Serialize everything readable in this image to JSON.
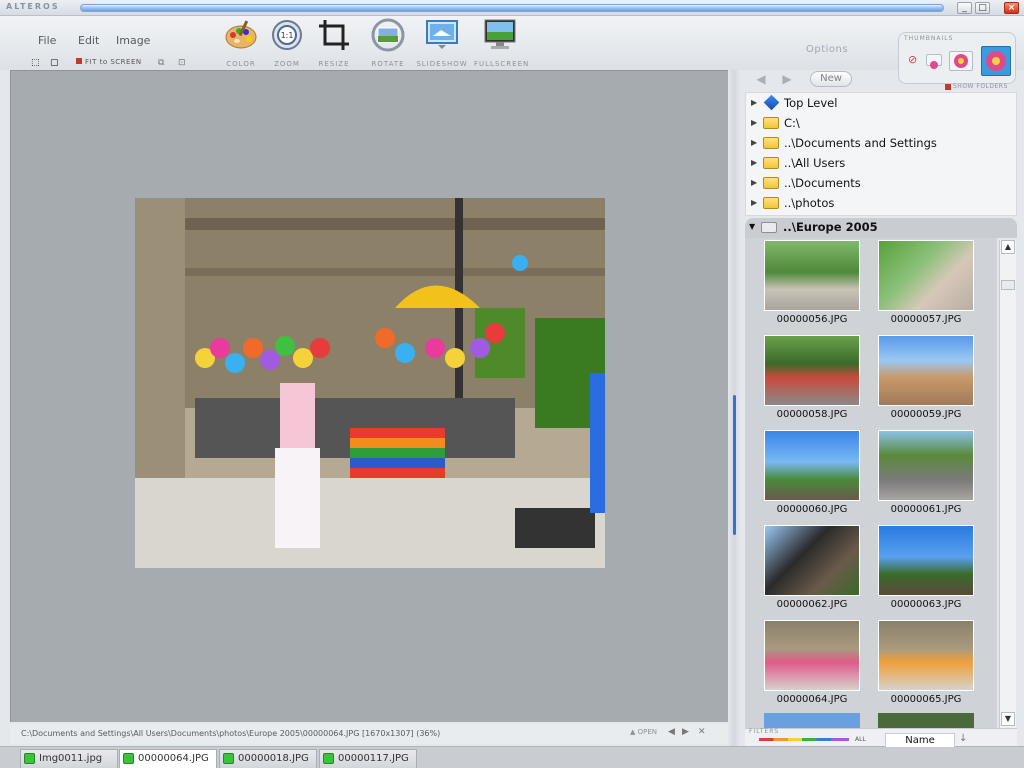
{
  "app": {
    "name": "ALTEROS"
  },
  "menu": {
    "file": "File",
    "edit": "Edit",
    "image": "Image"
  },
  "tools": [
    {
      "label": "COLOR",
      "icon": "palette-icon"
    },
    {
      "label": "ZOOM",
      "icon": "zoom-icon"
    },
    {
      "label": "RESIZE",
      "icon": "crop-icon"
    },
    {
      "label": "ROTATE",
      "icon": "rotate-icon"
    },
    {
      "label": "SLIDESHOW",
      "icon": "slideshow-icon"
    },
    {
      "label": "FULLSCREEN",
      "icon": "fullscreen-icon"
    }
  ],
  "options_label": "Options",
  "thumbnails_label": "THUMBNAILS",
  "fit_label": "FIT to SCREEN",
  "browser": {
    "new_label": "New",
    "show_folders": "SHOW FOLDERS",
    "tree": [
      {
        "label": "Top Level",
        "icon": "top-level-icon"
      },
      {
        "label": "C:\\",
        "icon": "folder-icon"
      },
      {
        "label": "..\\Documents and Settings",
        "icon": "folder-icon"
      },
      {
        "label": "..\\All Users",
        "icon": "folder-icon"
      },
      {
        "label": "..\\Documents",
        "icon": "folder-icon"
      },
      {
        "label": "..\\photos",
        "icon": "folder-icon"
      }
    ],
    "current_folder": "..\\Europe 2005",
    "thumbnails": [
      "00000056.JPG",
      "00000057.JPG",
      "00000058.JPG",
      "00000059.JPG",
      "00000060.JPG",
      "00000061.JPG",
      "00000062.JPG",
      "00000063.JPG",
      "00000064.JPG",
      "00000065.JPG"
    ],
    "filters_label": "FILTERS",
    "all_label": "ALL",
    "sort_label": "Name"
  },
  "status": {
    "path": "C:\\Documents and Settings\\All Users\\Documents\\photos\\Europe 2005\\00000064.JPG [1670x1307] (36%)",
    "open_label": "OPEN"
  },
  "tabs": [
    "Img0011.jpg",
    "00000064.JPG",
    "00000018.JPG",
    "00000117.JPG"
  ],
  "colors": {
    "accent": "#3a9cde",
    "tab_indicator": "#39c43b",
    "viewer_bg": "#a6abb0"
  }
}
